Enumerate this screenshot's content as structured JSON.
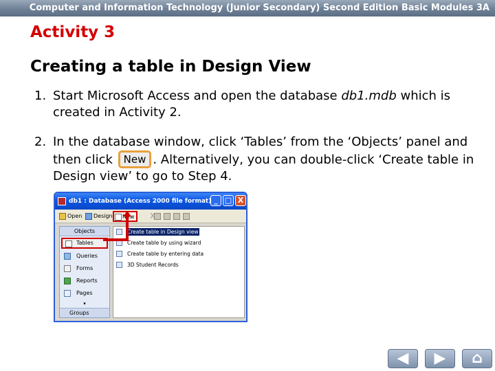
{
  "header": {
    "text": "Computer and Information Technology (Junior Secondary) Second Edition Basic Modules 3A"
  },
  "activity_title": "Activity 3",
  "section_title": "Creating a table in Design View",
  "steps": [
    {
      "number": "1.",
      "text_before": "Start Microsoft Access and open the database ",
      "emphasis": "db1.mdb",
      "text_after": " which is created in Activity 2."
    },
    {
      "number": "2.",
      "text_before": "In the database window, click ‘Tables’ from the ‘Objects’ panel and then click ",
      "button_label": "New",
      "text_after": ". Alternatively, you can double-click ‘Create table in Design view’ to go to Step 4."
    }
  ],
  "access_window": {
    "title": "db1 : Database (Access 2000 file format)",
    "window_buttons": [
      "_",
      "□",
      "X"
    ],
    "toolbar": {
      "open": "Open",
      "design": "Design",
      "new": "New",
      "delete": "X"
    },
    "objects_header": "Objects",
    "objects": [
      {
        "label": "Tables",
        "icon": "table-icon"
      },
      {
        "label": "Queries",
        "icon": "query-icon"
      },
      {
        "label": "Forms",
        "icon": "form-icon"
      },
      {
        "label": "Reports",
        "icon": "report-icon"
      },
      {
        "label": "Pages",
        "icon": "page-icon"
      }
    ],
    "more_chevron": "▾",
    "groups_label": "Groups",
    "list_items": [
      "Create table in Design view",
      "Create table by using wizard",
      "Create table by entering data",
      "3D Student Records"
    ]
  },
  "nav": {
    "prev": "◀",
    "next": "▶",
    "home": "⌂"
  }
}
